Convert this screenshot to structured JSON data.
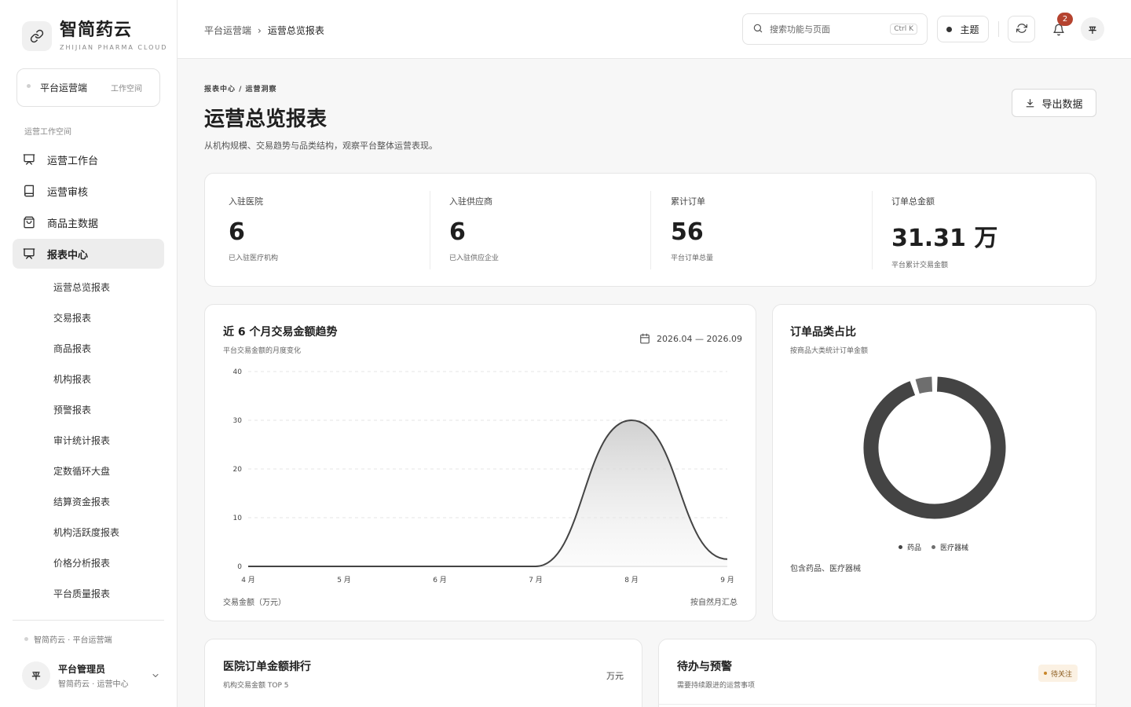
{
  "brand": {
    "title": "智简药云",
    "subtitle": "ZHIJIAN PHARMA CLOUD",
    "logo_icon": "link-icon"
  },
  "workspace": {
    "name": "平台运营端",
    "tag": "工作空间"
  },
  "sidebar": {
    "section_label": "运营工作空间",
    "items": [
      {
        "label": "运营工作台",
        "icon": "presentation-icon",
        "active": false
      },
      {
        "label": "运营审核",
        "icon": "book-icon",
        "active": false
      },
      {
        "label": "商品主数据",
        "icon": "shopping-bag-icon",
        "active": false
      },
      {
        "label": "报表中心",
        "icon": "presentation-icon",
        "active": true
      }
    ],
    "sub_items": [
      "运营总览报表",
      "交易报表",
      "商品报表",
      "机构报表",
      "预警报表",
      "审计统计报表",
      "定数循环大盘",
      "结算资金报表",
      "机构活跃度报表",
      "价格分析报表",
      "平台质量报表"
    ],
    "footer": "智简药云 · 平台运营端",
    "user": {
      "avatar": "平",
      "name": "平台管理员",
      "org": "智简药云 · 运营中心"
    }
  },
  "topbar": {
    "breadcrumb": [
      "平台运营端",
      "运营总览报表"
    ],
    "breadcrumb_sep": "›",
    "search_placeholder": "搜索功能与页面",
    "search_shortcut": "Ctrl K",
    "theme_label": "主题",
    "notification_count": "2",
    "avatar": "平"
  },
  "page": {
    "eyebrow": "报表中心 / 运营洞察",
    "title": "运营总览报表",
    "description": "从机构规模、交易趋势与品类结构，观察平台整体运营表现。",
    "export_label": "导出数据"
  },
  "kpis": [
    {
      "label": "入驻医院",
      "value": "6",
      "note": "已入驻医疗机构"
    },
    {
      "label": "入驻供应商",
      "value": "6",
      "note": "已入驻供应企业"
    },
    {
      "label": "累计订单",
      "value": "56",
      "note": "平台订单总量"
    },
    {
      "label": "订单总金额",
      "value": "31.31 万",
      "note": "平台累计交易金额"
    }
  ],
  "trend": {
    "title": "近 6 个月交易金额趋势",
    "subtitle": "平台交易金额的月度变化",
    "date_range": "2026.04 — 2026.09",
    "foot_left": "交易金额（万元）",
    "foot_right": "按自然月汇总"
  },
  "category": {
    "title": "订单品类占比",
    "subtitle": "按商品大类统计订单金额",
    "note": "包含药品、医疗器械"
  },
  "rank": {
    "title": "医院订单金额排行",
    "subtitle": "机构交易金额 TOP 5",
    "unit": "万元"
  },
  "todo": {
    "title": "待办与预警",
    "subtitle": "需要持续跟进的运营事项",
    "badge": "待关注"
  },
  "colors": {
    "accent": "#444444",
    "secondary": "#6e6e6e",
    "badge_bg": "#b5432f",
    "pending_bg": "#fbf1e3",
    "pending_text": "#8a5a1c"
  },
  "chart_data": [
    {
      "type": "area",
      "categories": [
        "4 月",
        "5 月",
        "6 月",
        "7 月",
        "8 月",
        "9 月"
      ],
      "series": [
        {
          "values": [
            0,
            0,
            0,
            0,
            30,
            1.5
          ]
        }
      ],
      "ylim": [
        0,
        40
      ],
      "yticks": [
        "0",
        "10",
        "20",
        "30",
        "40"
      ],
      "grid": true
    },
    {
      "type": "pie",
      "donut": true,
      "labels": [
        "药品",
        "医疗器械"
      ],
      "values": [
        95,
        5
      ],
      "colors": [
        "#444444",
        "#6e6e6e"
      ],
      "legend": "bottom"
    }
  ]
}
